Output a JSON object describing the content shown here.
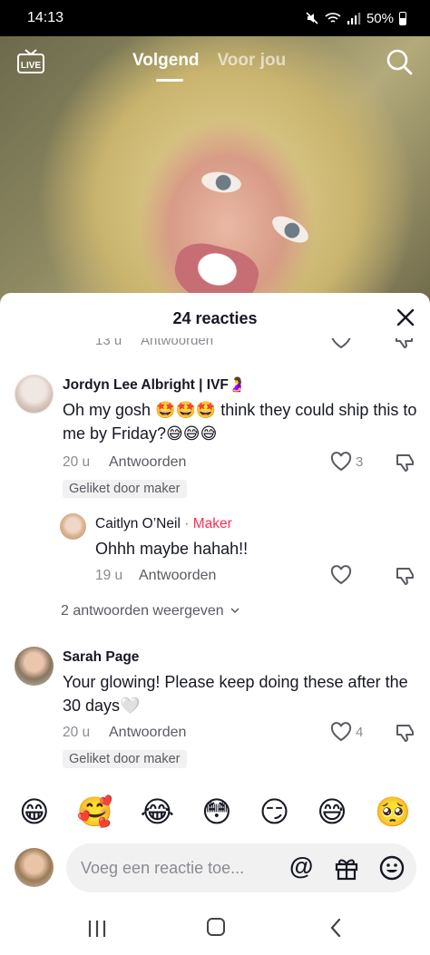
{
  "status": {
    "time": "14:13",
    "battery": "50%"
  },
  "nav": {
    "live_label": "LIVE",
    "tab_following": "Volgend",
    "tab_for_you": "Voor jou"
  },
  "sheet": {
    "title": "24 reacties"
  },
  "peek": {
    "time": "13 u",
    "reply_label": "Antwoorden"
  },
  "comments": [
    {
      "user": "Jordyn Lee Albright | IVF🤰",
      "text": "Oh my gosh 🤩🤩🤩 think they could ship this to me by Friday?😅😅😅",
      "time": "20 u",
      "reply_label": "Antwoorden",
      "likes": "3",
      "badge": "Geliket door maker"
    },
    {
      "user": "Sarah Page",
      "text": "Your glowing! Please keep doing these after the 30 days🤍",
      "time": "20 u",
      "reply_label": "Antwoorden",
      "likes": "4",
      "badge": "Geliket door maker"
    }
  ],
  "reply": {
    "user": "Caitlyn O’Neil",
    "separator": "·",
    "maker_label": "Maker",
    "text": "Ohhh maybe hahah!!",
    "time": "19 u",
    "reply_label": "Antwoorden"
  },
  "view_replies": "2 antwoorden weergeven",
  "emojis": [
    "😁",
    "🥰",
    "😂",
    "😳",
    "😏",
    "😅",
    "🥺"
  ],
  "input": {
    "placeholder": "Voeg een reactie toe...",
    "at_symbol": "@"
  },
  "colors": {
    "accent": "#fe2c55",
    "text": "#161823",
    "muted": "#8a8b91"
  },
  "icons": [
    "live-icon",
    "search-icon",
    "close-icon",
    "heart-icon",
    "dislike-icon",
    "chevron-down-icon",
    "at-icon",
    "gift-icon",
    "emoji-icon"
  ]
}
